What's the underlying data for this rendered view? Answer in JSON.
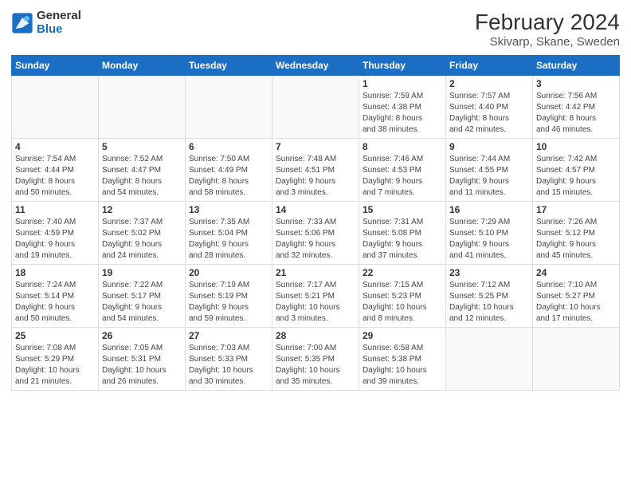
{
  "header": {
    "logo_general": "General",
    "logo_blue": "Blue",
    "title": "February 2024",
    "subtitle": "Skivarp, Skane, Sweden"
  },
  "days_of_week": [
    "Sunday",
    "Monday",
    "Tuesday",
    "Wednesday",
    "Thursday",
    "Friday",
    "Saturday"
  ],
  "weeks": [
    [
      {
        "day": "",
        "info": ""
      },
      {
        "day": "",
        "info": ""
      },
      {
        "day": "",
        "info": ""
      },
      {
        "day": "",
        "info": ""
      },
      {
        "day": "1",
        "info": "Sunrise: 7:59 AM\nSunset: 4:38 PM\nDaylight: 8 hours\nand 38 minutes."
      },
      {
        "day": "2",
        "info": "Sunrise: 7:57 AM\nSunset: 4:40 PM\nDaylight: 8 hours\nand 42 minutes."
      },
      {
        "day": "3",
        "info": "Sunrise: 7:56 AM\nSunset: 4:42 PM\nDaylight: 8 hours\nand 46 minutes."
      }
    ],
    [
      {
        "day": "4",
        "info": "Sunrise: 7:54 AM\nSunset: 4:44 PM\nDaylight: 8 hours\nand 50 minutes."
      },
      {
        "day": "5",
        "info": "Sunrise: 7:52 AM\nSunset: 4:47 PM\nDaylight: 8 hours\nand 54 minutes."
      },
      {
        "day": "6",
        "info": "Sunrise: 7:50 AM\nSunset: 4:49 PM\nDaylight: 8 hours\nand 58 minutes."
      },
      {
        "day": "7",
        "info": "Sunrise: 7:48 AM\nSunset: 4:51 PM\nDaylight: 9 hours\nand 3 minutes."
      },
      {
        "day": "8",
        "info": "Sunrise: 7:46 AM\nSunset: 4:53 PM\nDaylight: 9 hours\nand 7 minutes."
      },
      {
        "day": "9",
        "info": "Sunrise: 7:44 AM\nSunset: 4:55 PM\nDaylight: 9 hours\nand 11 minutes."
      },
      {
        "day": "10",
        "info": "Sunrise: 7:42 AM\nSunset: 4:57 PM\nDaylight: 9 hours\nand 15 minutes."
      }
    ],
    [
      {
        "day": "11",
        "info": "Sunrise: 7:40 AM\nSunset: 4:59 PM\nDaylight: 9 hours\nand 19 minutes."
      },
      {
        "day": "12",
        "info": "Sunrise: 7:37 AM\nSunset: 5:02 PM\nDaylight: 9 hours\nand 24 minutes."
      },
      {
        "day": "13",
        "info": "Sunrise: 7:35 AM\nSunset: 5:04 PM\nDaylight: 9 hours\nand 28 minutes."
      },
      {
        "day": "14",
        "info": "Sunrise: 7:33 AM\nSunset: 5:06 PM\nDaylight: 9 hours\nand 32 minutes."
      },
      {
        "day": "15",
        "info": "Sunrise: 7:31 AM\nSunset: 5:08 PM\nDaylight: 9 hours\nand 37 minutes."
      },
      {
        "day": "16",
        "info": "Sunrise: 7:29 AM\nSunset: 5:10 PM\nDaylight: 9 hours\nand 41 minutes."
      },
      {
        "day": "17",
        "info": "Sunrise: 7:26 AM\nSunset: 5:12 PM\nDaylight: 9 hours\nand 45 minutes."
      }
    ],
    [
      {
        "day": "18",
        "info": "Sunrise: 7:24 AM\nSunset: 5:14 PM\nDaylight: 9 hours\nand 50 minutes."
      },
      {
        "day": "19",
        "info": "Sunrise: 7:22 AM\nSunset: 5:17 PM\nDaylight: 9 hours\nand 54 minutes."
      },
      {
        "day": "20",
        "info": "Sunrise: 7:19 AM\nSunset: 5:19 PM\nDaylight: 9 hours\nand 59 minutes."
      },
      {
        "day": "21",
        "info": "Sunrise: 7:17 AM\nSunset: 5:21 PM\nDaylight: 10 hours\nand 3 minutes."
      },
      {
        "day": "22",
        "info": "Sunrise: 7:15 AM\nSunset: 5:23 PM\nDaylight: 10 hours\nand 8 minutes."
      },
      {
        "day": "23",
        "info": "Sunrise: 7:12 AM\nSunset: 5:25 PM\nDaylight: 10 hours\nand 12 minutes."
      },
      {
        "day": "24",
        "info": "Sunrise: 7:10 AM\nSunset: 5:27 PM\nDaylight: 10 hours\nand 17 minutes."
      }
    ],
    [
      {
        "day": "25",
        "info": "Sunrise: 7:08 AM\nSunset: 5:29 PM\nDaylight: 10 hours\nand 21 minutes."
      },
      {
        "day": "26",
        "info": "Sunrise: 7:05 AM\nSunset: 5:31 PM\nDaylight: 10 hours\nand 26 minutes."
      },
      {
        "day": "27",
        "info": "Sunrise: 7:03 AM\nSunset: 5:33 PM\nDaylight: 10 hours\nand 30 minutes."
      },
      {
        "day": "28",
        "info": "Sunrise: 7:00 AM\nSunset: 5:35 PM\nDaylight: 10 hours\nand 35 minutes."
      },
      {
        "day": "29",
        "info": "Sunrise: 6:58 AM\nSunset: 5:38 PM\nDaylight: 10 hours\nand 39 minutes."
      },
      {
        "day": "",
        "info": ""
      },
      {
        "day": "",
        "info": ""
      }
    ]
  ]
}
